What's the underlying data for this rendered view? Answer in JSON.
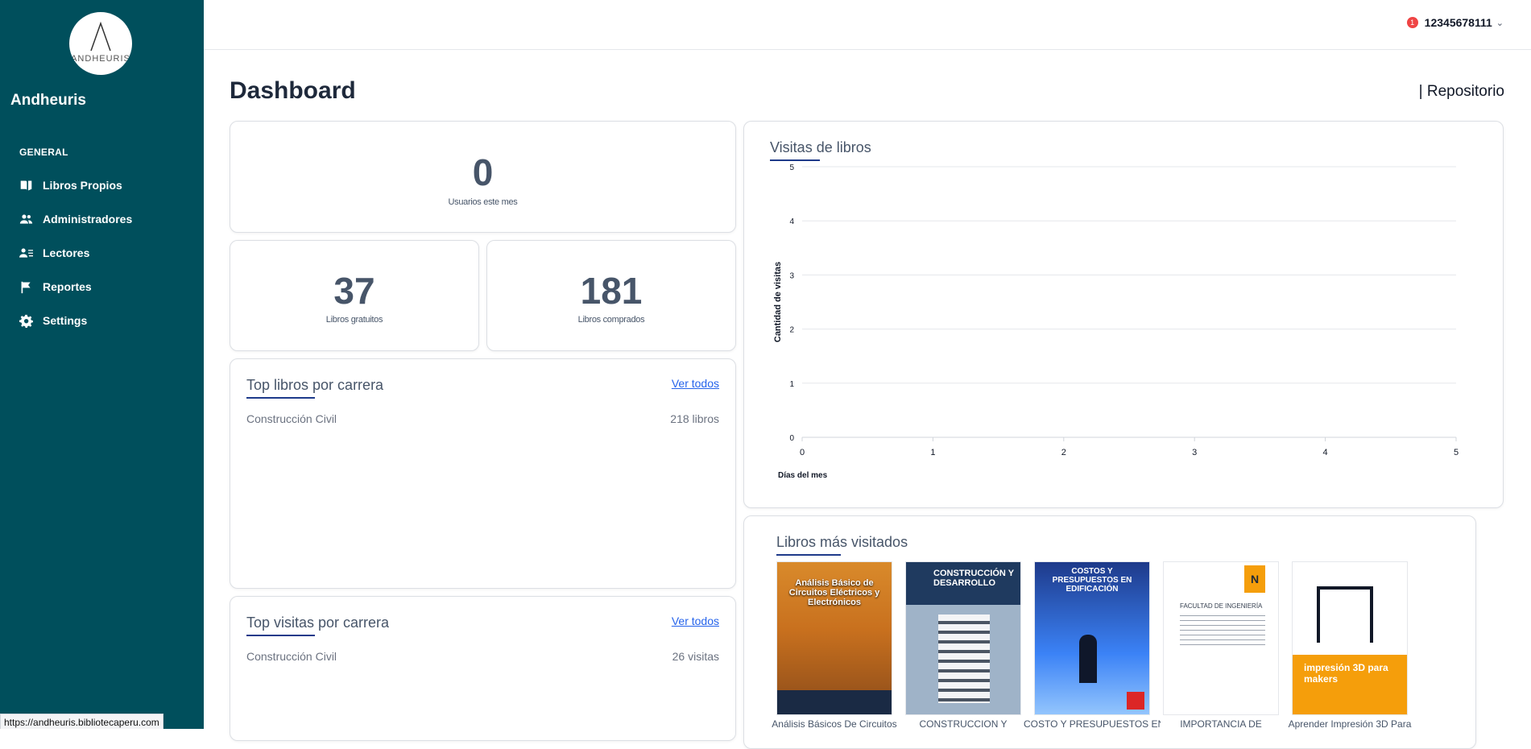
{
  "sidebar": {
    "logo_text": "ANDHEURIS",
    "brand": "Andheuris",
    "section": "GENERAL",
    "items": [
      {
        "label": "Libros Propios",
        "icon": "book-icon"
      },
      {
        "label": "Administradores",
        "icon": "users-icon"
      },
      {
        "label": "Lectores",
        "icon": "readers-icon"
      },
      {
        "label": "Reportes",
        "icon": "flag-icon"
      },
      {
        "label": "Settings",
        "icon": "gear-icon"
      }
    ]
  },
  "header": {
    "notification_count": "1",
    "username": "12345678111"
  },
  "page": {
    "title": "Dashboard",
    "repo_link": "| Repositorio"
  },
  "stats": {
    "users": {
      "value": "0",
      "label": "Usuarios este mes"
    },
    "free": {
      "value": "37",
      "label": "Libros gratuitos"
    },
    "bought": {
      "value": "181",
      "label": "Libros comprados"
    }
  },
  "top_books": {
    "title": "Top libros por carrera",
    "link": "Ver todos",
    "rows": [
      {
        "name": "Construcción Civil",
        "count": "218 libros"
      }
    ]
  },
  "top_visits": {
    "title": "Top visitas por carrera",
    "link": "Ver todos",
    "rows": [
      {
        "name": "Construcción Civil",
        "count": "26 visitas"
      }
    ]
  },
  "chart_data": {
    "type": "line",
    "title": "Visitas de libros",
    "xlabel": "Días del mes",
    "ylabel": "Cantidad de visitas",
    "xlim": [
      0,
      5
    ],
    "ylim": [
      0,
      5
    ],
    "xticks": [
      "0",
      "1",
      "2",
      "3",
      "4",
      "5"
    ],
    "yticks": [
      "0",
      "1",
      "2",
      "3",
      "4",
      "5"
    ],
    "grid": true,
    "series": []
  },
  "popular": {
    "title": "Libros más visitados",
    "books": [
      {
        "title": "Análisis Básicos De Circuitos",
        "cover_text": "Análisis Básico de Circuitos Eléctricos y Electrónicos",
        "color": "#c8701e"
      },
      {
        "title": "CONSTRUCCION Y",
        "cover_text": "CONSTRUCCIÓN Y DESARROLLO",
        "color": "#1f3a5f"
      },
      {
        "title": "COSTO Y PRESUPUESTOS EN",
        "cover_text": "COSTOS Y PRESUPUESTOS EN EDIFICACIÓN",
        "color": "#1d4ed8"
      },
      {
        "title": "IMPORTANCIA DE",
        "cover_text": "FACULTAD DE INGENIERÍA",
        "color": "#ffffff"
      },
      {
        "title": "Aprender Impresión 3D Para",
        "cover_text": "impresión 3D para makers",
        "color": "#f59e0b"
      }
    ]
  },
  "status_url": "https://andheuris.bibliotecaperu.com"
}
